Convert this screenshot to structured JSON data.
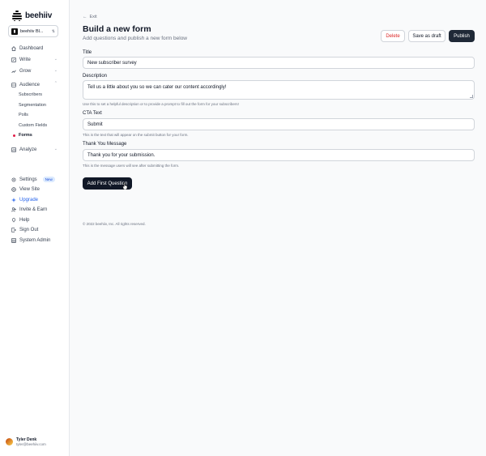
{
  "sidebar": {
    "brand": "beehiiv",
    "publication": "beehiiv Bl...",
    "nav": {
      "dashboard": "Dashboard",
      "write": "Write",
      "grow": "Grow",
      "audience": "Audience",
      "subscribers": "Subscribers",
      "segmentation": "Segmentation",
      "polls": "Polls",
      "custom_fields": "Custom Fields",
      "forms": "Forms",
      "analyze": "Analyze",
      "settings": "Settings",
      "settings_badge": "New",
      "view_site": "View Site",
      "upgrade": "Upgrade",
      "invite_earn": "Invite & Earn",
      "help": "Help",
      "sign_out": "Sign Out",
      "system_admin": "System Admin"
    },
    "user": {
      "name": "Tyler Denk",
      "email": "tyler@beehiiv.com"
    }
  },
  "main": {
    "exit": "Exit",
    "title": "Build a new form",
    "subtitle": "Add questions and publish a new form below",
    "buttons": {
      "delete": "Delete",
      "save_draft": "Save as draft",
      "publish": "Publish",
      "add_question": "Add First Question"
    },
    "fields": {
      "title_label": "Title",
      "title_value": "New subscriber survey",
      "description_label": "Description",
      "description_value": "Tell us a little about you so we can cater our content accordingly!",
      "description_help": "Use this to set a helpful description or to provide a prompt to fill out the form for your subscribers!",
      "cta_label": "CTA Text",
      "cta_value": "Submit",
      "cta_help": "This is the text that will appear on the submit button for your form.",
      "thanks_label": "Thank You Message",
      "thanks_value": "Thank you for your submission.",
      "thanks_help": "This is the message users will see after submitting the form."
    },
    "footer": "© 2022 beehiiv, Inc. All rights reserved."
  },
  "colors": {
    "primary": "#1f2937",
    "danger": "#dc2626",
    "link": "#2563eb",
    "active_dot": "#e11d48"
  }
}
